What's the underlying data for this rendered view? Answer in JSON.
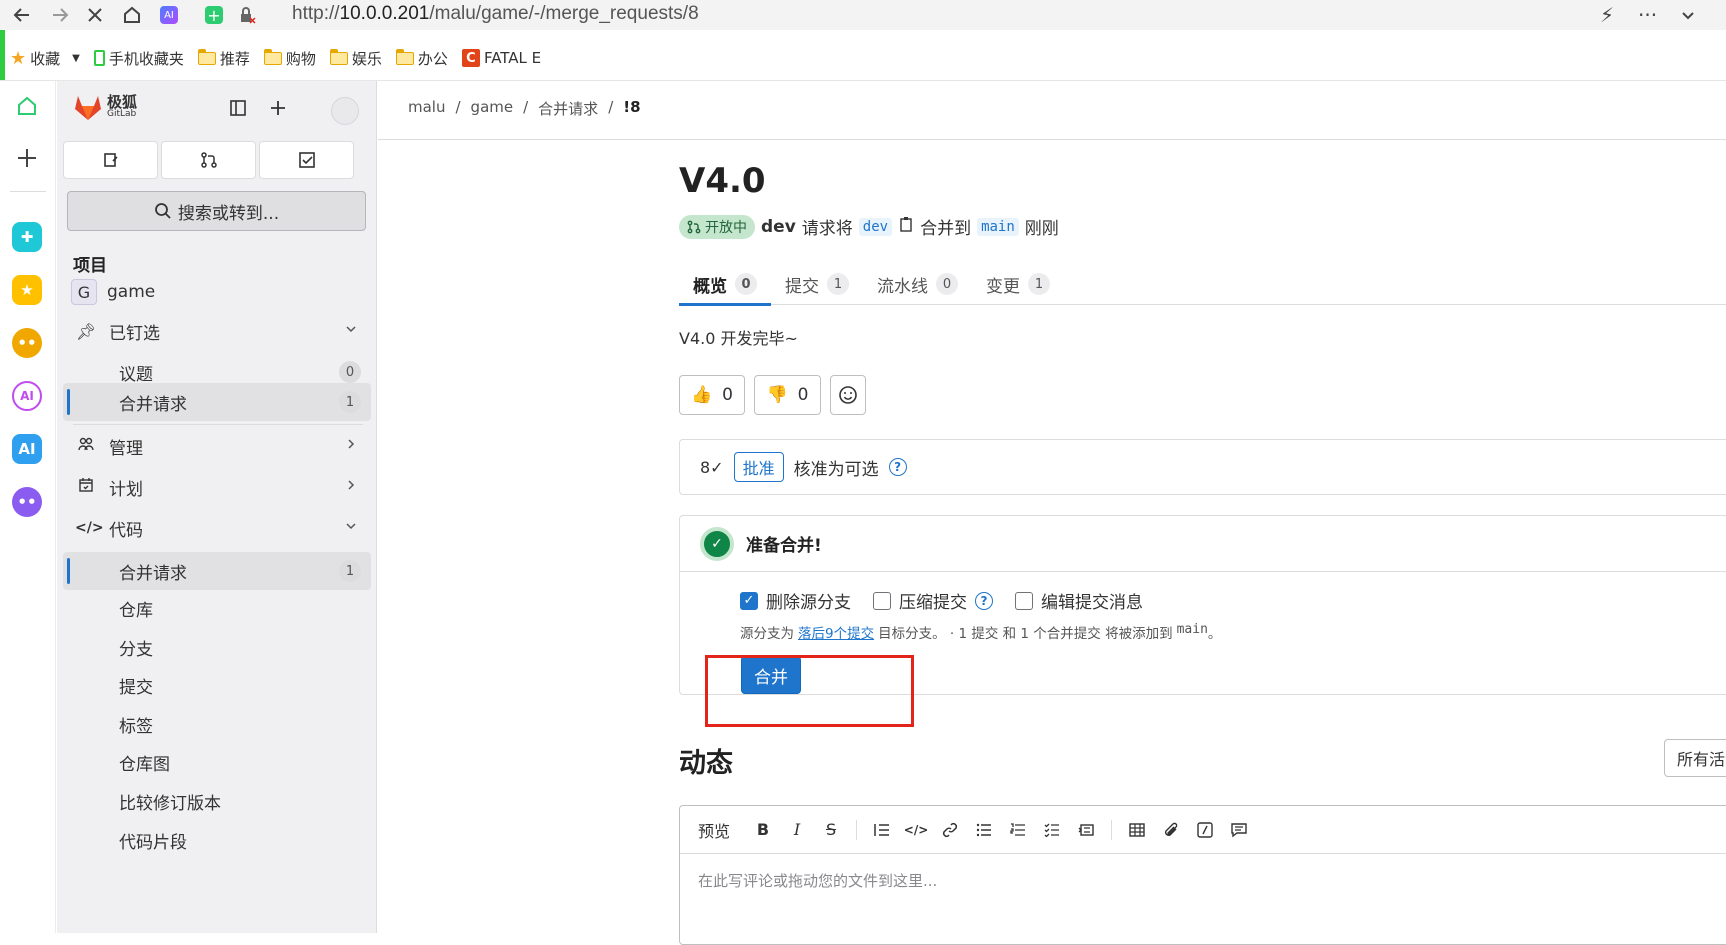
{
  "browser": {
    "url_prefix": "http://",
    "url_host": "10.0.0.201",
    "url_path": "/malu/game/-/merge_requests/8",
    "bookmarks": [
      {
        "label": "收藏",
        "kind": "star"
      },
      {
        "label": "手机收藏夹",
        "kind": "phone"
      },
      {
        "label": "推荐",
        "kind": "folder"
      },
      {
        "label": "购物",
        "kind": "folder"
      },
      {
        "label": "娱乐",
        "kind": "folder"
      },
      {
        "label": "办公",
        "kind": "folder"
      },
      {
        "label": "FATAL E",
        "kind": "red"
      }
    ]
  },
  "sidebar": {
    "brand": "极狐",
    "brand_sub": "GitLab",
    "search_placeholder": "搜索或转到...",
    "section_title": "项目",
    "project_initial": "G",
    "project_name": "game",
    "pinned_label": "已钉选",
    "pinned_items": [
      {
        "label": "议题",
        "count": "0"
      },
      {
        "label": "合并请求",
        "count": "1"
      }
    ],
    "manage_label": "管理",
    "plan_label": "计划",
    "code_label": "代码",
    "code_items": [
      {
        "label": "合并请求",
        "count": "1"
      },
      {
        "label": "仓库"
      },
      {
        "label": "分支"
      },
      {
        "label": "提交"
      },
      {
        "label": "标签"
      },
      {
        "label": "仓库图"
      },
      {
        "label": "比较修订版本"
      },
      {
        "label": "代码片段"
      }
    ]
  },
  "breadcrumb": [
    "malu",
    "game",
    "合并请求",
    "!8"
  ],
  "mr": {
    "title": "V4.0",
    "status": "开放中",
    "author": "dev",
    "request_text": "请求将",
    "source_branch": "dev",
    "merge_to_text": "合并到",
    "target_branch": "main",
    "time": "刚刚",
    "tabs": [
      {
        "label": "概览",
        "count": "0"
      },
      {
        "label": "提交",
        "count": "1"
      },
      {
        "label": "流水线",
        "count": "0"
      },
      {
        "label": "变更",
        "count": "1"
      }
    ],
    "description": "V4.0 开发完毕~",
    "thumbs_up": "0",
    "thumbs_down": "0",
    "approve_button": "批准",
    "approve_text": "核准为可选",
    "ready_text": "准备合并!",
    "options": {
      "delete_source": "删除源分支",
      "squash": "压缩提交",
      "edit_message": "编辑提交消息"
    },
    "note_prefix": "源分支为",
    "note_link": "落后9个提交",
    "note_mid": "目标分支。 · 1 提交 和 1 个合并提交 将被添加到",
    "note_branch": "main",
    "note_suffix": "。",
    "merge_button": "合并",
    "activity_title": "动态",
    "activity_filter": "所有活动",
    "editor_preview": "预览",
    "editor_placeholder": "在此写评论或拖动您的文件到这里..."
  },
  "colors": {
    "accent": "#1f75cb",
    "highlight_box": "#e2241a",
    "open_badge": "#c3e6cd"
  }
}
